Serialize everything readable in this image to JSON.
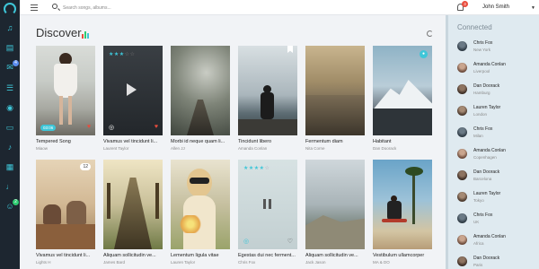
{
  "topbar": {
    "search_placeholder": "Search songs, albums...",
    "notification_count": "3",
    "user_name": "John Smith"
  },
  "main": {
    "title": "Discover"
  },
  "cards": [
    {
      "title": "Tempered Song",
      "artist": "Miaow",
      "duration": "03:06",
      "liked": true
    },
    {
      "title": "Vivamus vel tincidunt li...",
      "artist": "Laurent Taylor",
      "rating": 3,
      "liked": true
    },
    {
      "title": "Morbi id neque quam li...",
      "artist": "Allen JJ"
    },
    {
      "title": "Tincidunt libero",
      "artist": "Amanda Conlan"
    },
    {
      "title": "Fermentum diam",
      "artist": "Nita Corne"
    },
    {
      "title": "Habitant",
      "artist": "Dan Doorack"
    },
    {
      "title": "Vivamus vel tincidunt li...",
      "artist": "Lights H",
      "count": "12"
    },
    {
      "title": "Aliquam sollicitudin ve...",
      "artist": "James Bard"
    },
    {
      "title": "Lementum ligula vitae",
      "artist": "Lauren Taylor"
    },
    {
      "title": "Egestas dui nec ferment...",
      "artist": "Chris Fox",
      "rating": 4
    },
    {
      "title": "Aliquam sollicitudin ve...",
      "artist": "Jack Jason"
    },
    {
      "title": "Vestibulum ullamcorper",
      "artist": "MA & DO"
    }
  ],
  "panel": {
    "title": "Connected",
    "contacts": [
      {
        "name": "Chris Fox",
        "location": "New York"
      },
      {
        "name": "Amanda Conlan",
        "location": "Liverpool"
      },
      {
        "name": "Dan Doorack",
        "location": "Hamburg"
      },
      {
        "name": "Lauren Taylor",
        "location": "London"
      },
      {
        "name": "Chris Fox",
        "location": "Milan"
      },
      {
        "name": "Amanda Conlan",
        "location": "Copenhagen"
      },
      {
        "name": "Dan Doorack",
        "location": "Barcelona"
      },
      {
        "name": "Lauren Taylor",
        "location": "Tokyo"
      },
      {
        "name": "Chris Fox",
        "location": "UK"
      },
      {
        "name": "Amanda Conlan",
        "location": "Africa"
      },
      {
        "name": "Dan Doorack",
        "location": "Paris"
      }
    ]
  },
  "colors": {
    "accent": "#3ec6d8",
    "rail": "#1d2630",
    "heart": "#e84c3d",
    "star": "#3ec6d8"
  }
}
